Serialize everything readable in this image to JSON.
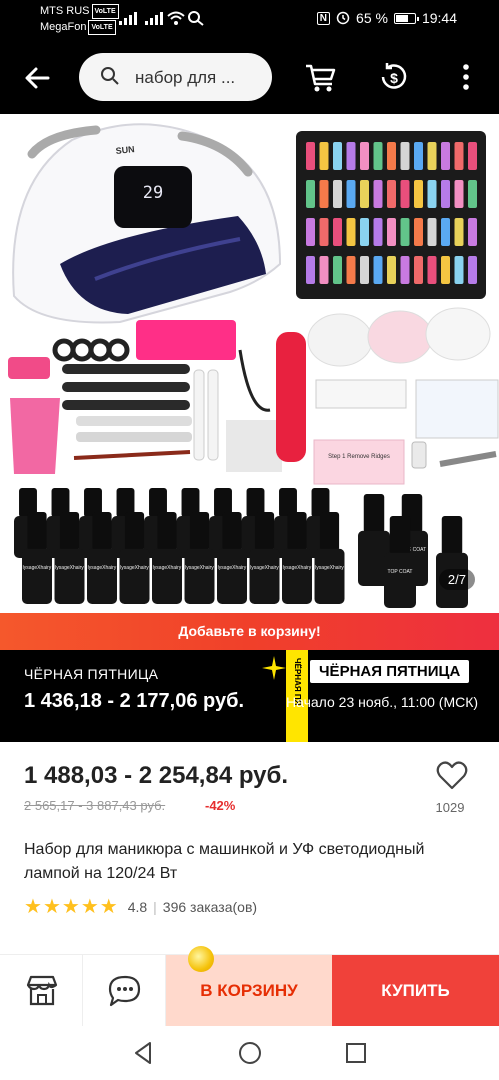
{
  "status_bar": {
    "carrier1": "MTS RUS",
    "carrier2": "MegaFon",
    "volte": "VoLTE",
    "nfc": "N",
    "battery": "65 %",
    "battery_level": 0.65,
    "time": "19:44"
  },
  "header": {
    "search_text": "набор для ...",
    "icons": [
      "back-arrow-icon",
      "search-icon",
      "cart-icon",
      "coin-icon",
      "more-icon"
    ]
  },
  "gallery": {
    "counter": "2/7",
    "lamp_display": "29",
    "lamp_brand": "SUN",
    "polish_brand": "lysageXhairy",
    "polish_labels": [
      "Gel Polish",
      "SOAK-OFF",
      "UV&LED"
    ],
    "top_coat": "TOP COAT",
    "base_coat": "BASE COAT",
    "buffer_label": "Step 1 Remove Ridges"
  },
  "promo": {
    "add_to_cart_banner": "Добавьте в корзину!",
    "bf_label": "ЧЁРНАЯ ПЯТНИЦА",
    "bf_price": "1 436,18 - 2 177,06 руб.",
    "bf_badge": "ЧЁРНАЯ ПЯТНИЦА",
    "bf_tape": "ЧЁРНАЯ ПЯ",
    "bf_start": "Начало 23 нояб., 11:00 (МСК)",
    "colors": {
      "banner": "#f0402a",
      "tape": "#ffe500"
    }
  },
  "price": {
    "current": "1 488,03 - 2 254,84 руб.",
    "old": "2 565,17 - 3 887,43 руб.",
    "discount": "-42%",
    "wishlist_count": "1029"
  },
  "product": {
    "title": "Набор для маникюра с машинкой и УФ светодиодный лампой на 120/24 Вт",
    "rating": "4.8",
    "stars": 5,
    "orders": "396 заказа(ов)"
  },
  "actions": {
    "cart_label": "В КОРЗИНУ",
    "buy_label": "КУПИТЬ",
    "icons": [
      "store-icon",
      "chat-icon"
    ],
    "colors": {
      "buy": "#f0413a",
      "cart_bg": "#ffd9cc",
      "accent": "#e62e04"
    }
  }
}
